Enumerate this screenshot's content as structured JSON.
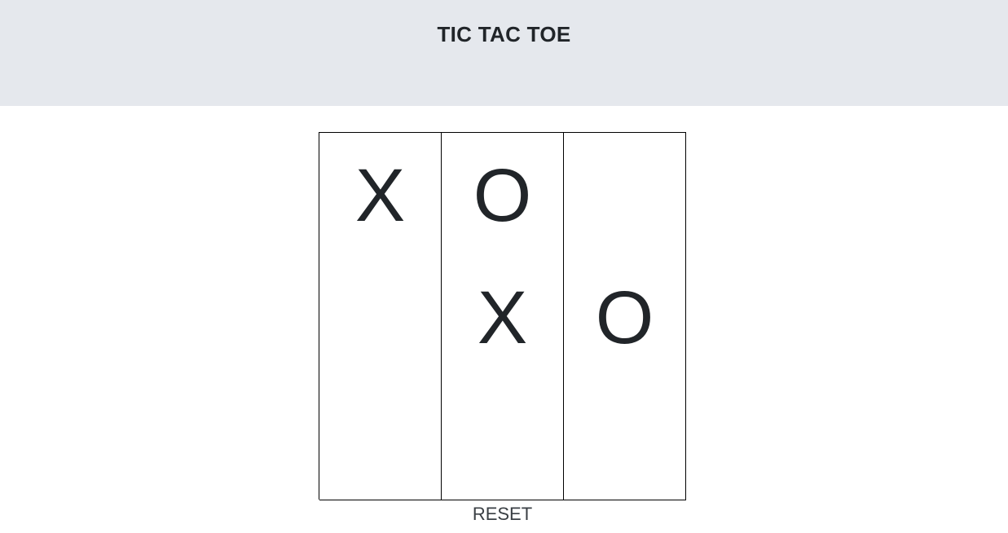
{
  "header": {
    "title": "TIC TAC TOE"
  },
  "board": {
    "cells": [
      "X",
      "O",
      "",
      "",
      "X",
      "O",
      "",
      "",
      ""
    ]
  },
  "controls": {
    "reset_label": "RESET"
  }
}
